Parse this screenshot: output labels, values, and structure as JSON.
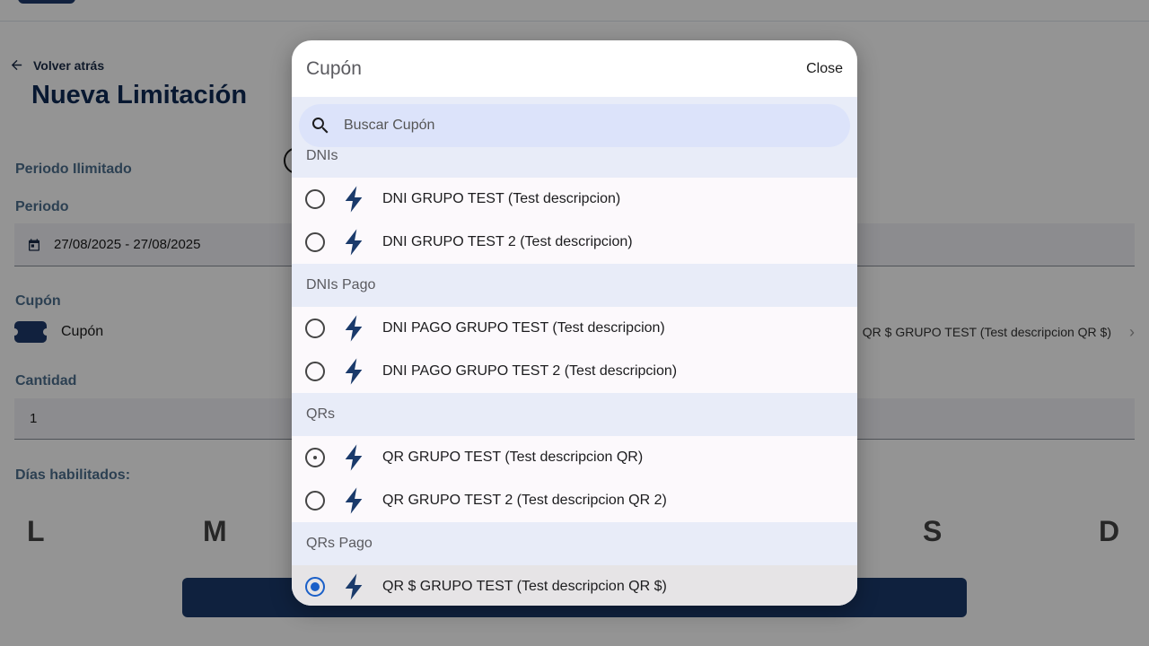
{
  "background": {
    "back_link": "Volver atrás",
    "page_title": "Nueva Limitación",
    "periodo_ilimitado_label": "Periodo Ilimitado",
    "periodo_label": "Periodo",
    "periodo_value": "27/08/2025 - 27/08/2025",
    "cupon_label": "Cupón",
    "cupon_row_text": "Cupón",
    "cupon_selected_value": "QR $ GRUPO TEST (Test descripcion QR $)",
    "cantidad_label": "Cantidad",
    "cantidad_value": "1",
    "dias_label": "Días habilitados:",
    "days_visible": [
      "L",
      "M",
      "S",
      "D"
    ]
  },
  "modal": {
    "title": "Cupón",
    "close_label": "Close",
    "search_placeholder": "Buscar Cupón",
    "groups": [
      {
        "name": "DNIs",
        "items": [
          {
            "label": "DNI GRUPO TEST (Test descripcion)",
            "state": "unchecked"
          },
          {
            "label": "DNI GRUPO TEST 2 (Test descripcion)",
            "state": "unchecked"
          }
        ]
      },
      {
        "name": "DNIs Pago",
        "items": [
          {
            "label": "DNI PAGO GRUPO TEST (Test descripcion)",
            "state": "unchecked"
          },
          {
            "label": "DNI PAGO GRUPO TEST 2 (Test descripcion)",
            "state": "unchecked"
          }
        ]
      },
      {
        "name": "QRs",
        "items": [
          {
            "label": "QR GRUPO TEST (Test descripcion QR)",
            "state": "focused"
          },
          {
            "label": "QR GRUPO TEST 2 (Test descripcion QR 2)",
            "state": "unchecked"
          }
        ]
      },
      {
        "name": "QRs Pago",
        "items": [
          {
            "label": "QR $ GRUPO TEST (Test descripcion QR $)",
            "state": "checked"
          }
        ]
      }
    ],
    "item_icon": "bolt-icon"
  },
  "colors": {
    "brand_navy": "#1a3a6b",
    "selected_radio": "#1a5fc8",
    "label_teal": "#4d6f8e"
  }
}
